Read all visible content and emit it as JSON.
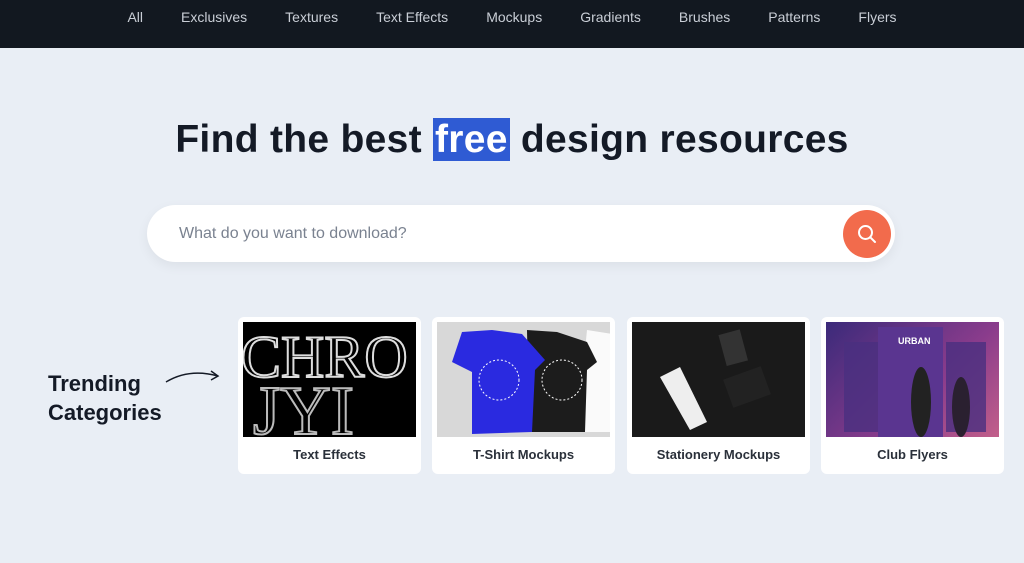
{
  "nav": {
    "items": [
      "All",
      "Exclusives",
      "Textures",
      "Text Effects",
      "Mockups",
      "Gradients",
      "Brushes",
      "Patterns",
      "Flyers"
    ]
  },
  "hero": {
    "title_before": "Find the best ",
    "title_highlight": "free",
    "title_after": " design resources",
    "highlight_color": "#2f5bd3"
  },
  "search": {
    "placeholder": "What do you want to download?",
    "value": "",
    "button_icon": "search-icon",
    "button_color": "#f26b4c"
  },
  "trending": {
    "line1": "Trending",
    "line2": "Categories",
    "cards": [
      {
        "label": "Text Effects",
        "thumb_text": "CHRO"
      },
      {
        "label": "T-Shirt Mockups"
      },
      {
        "label": "Stationery Mockups"
      },
      {
        "label": "Club Flyers",
        "thumb_text": "URBAN"
      }
    ]
  }
}
